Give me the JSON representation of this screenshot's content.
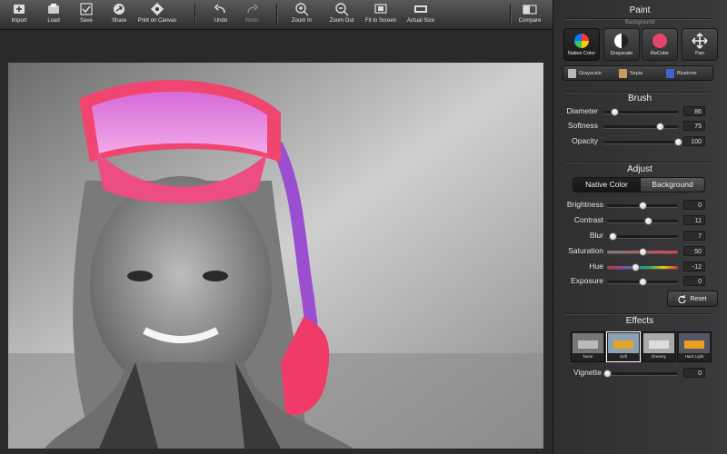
{
  "toolbar": {
    "items": [
      {
        "label": "Import",
        "icon": "import-icon"
      },
      {
        "label": "Load",
        "icon": "load-icon"
      },
      {
        "label": "Save",
        "icon": "save-icon"
      },
      {
        "label": "Share",
        "icon": "share-icon"
      },
      {
        "label": "Print on Canvas",
        "icon": "print-canvas-icon"
      },
      {
        "label": "Undo",
        "icon": "undo-icon"
      },
      {
        "label": "Redo",
        "icon": "redo-icon"
      },
      {
        "label": "Zoom In",
        "icon": "zoom-in-icon"
      },
      {
        "label": "Zoom Out",
        "icon": "zoom-out-icon"
      },
      {
        "label": "Fit to Screen",
        "icon": "fit-screen-icon"
      },
      {
        "label": "Actual Size",
        "icon": "actual-size-icon"
      },
      {
        "label": "Compare",
        "icon": "compare-icon"
      }
    ]
  },
  "paint": {
    "title": "Paint",
    "mode_legend": "Background",
    "modes": [
      {
        "label": "Native Color",
        "icon": "color-wheel-icon"
      },
      {
        "label": "Grayscale",
        "icon": "grayscale-icon"
      },
      {
        "label": "ReColor",
        "icon": "recolor-icon"
      },
      {
        "label": "Pan",
        "icon": "pan-icon"
      }
    ],
    "tones": [
      {
        "label": "Grayscale",
        "color": "#b8b8b8"
      },
      {
        "label": "Sepia",
        "color": "#c79a5b"
      },
      {
        "label": "Bluetone",
        "color": "#3f63c9"
      }
    ]
  },
  "brush": {
    "title": "Brush",
    "sliders": [
      {
        "label": "Diameter",
        "value": "86",
        "level": 0.15
      },
      {
        "label": "Softness",
        "value": "75",
        "level": 0.75
      },
      {
        "label": "Opacity",
        "value": "100",
        "level": 1.0
      }
    ]
  },
  "adjust": {
    "title": "Adjust",
    "tabs": [
      "Native Color",
      "Background"
    ],
    "sliders": [
      {
        "label": "Brightness",
        "value": "0",
        "level": 0.5,
        "track": "#1c1c1c"
      },
      {
        "label": "Contrast",
        "value": "11",
        "level": 0.58,
        "track": "#1c1c1c"
      },
      {
        "label": "Blur",
        "value": "7",
        "level": 0.08,
        "track": "#1c1c1c"
      },
      {
        "label": "Saturation",
        "value": "50",
        "level": 0.5,
        "track": "gradient-saturation"
      },
      {
        "label": "Hue",
        "value": "-12",
        "level": 0.4,
        "track": "gradient-hue"
      },
      {
        "label": "Exposure",
        "value": "0",
        "level": 0.5,
        "track": "#1c1c1c"
      }
    ],
    "reset_label": "Reset"
  },
  "effects": {
    "title": "Effects",
    "items": [
      {
        "label": "None"
      },
      {
        "label": "Soft"
      },
      {
        "label": "Dreamy"
      },
      {
        "label": "Hard Light"
      }
    ],
    "vignette": {
      "label": "Vignette",
      "value": "0",
      "level": 0.0
    }
  }
}
